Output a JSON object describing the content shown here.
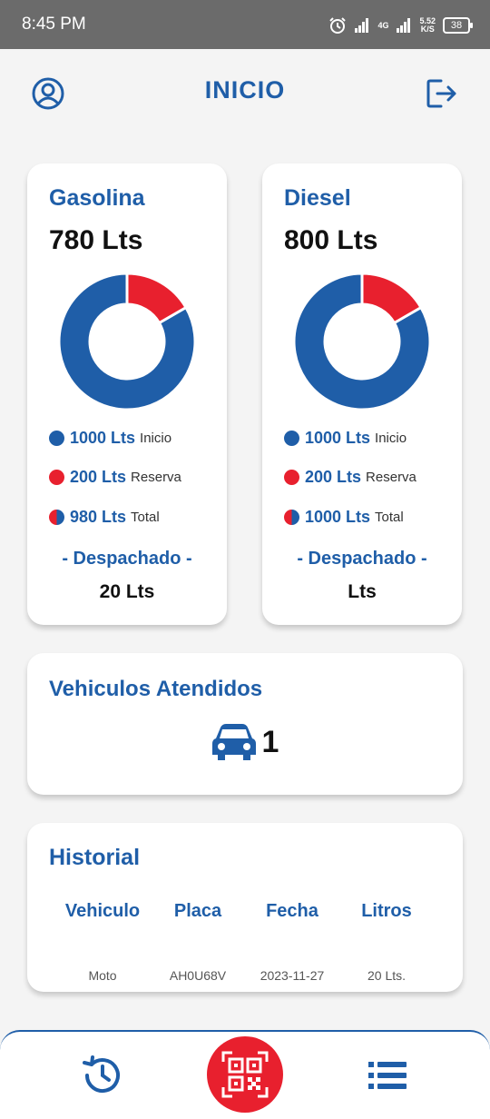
{
  "status_bar": {
    "time": "8:45 PM",
    "network": "4G",
    "speed": "5.52",
    "speed_unit": "K/S",
    "battery": "38"
  },
  "header": {
    "title": "INICIO",
    "profile_icon": "user-circle-icon",
    "logout_icon": "logout-icon"
  },
  "colors": {
    "primary": "#1f5ea8",
    "accent": "#e8202e"
  },
  "fuel_cards": [
    {
      "title": "Gasolina",
      "amount": "780 Lts",
      "chart_data": {
        "type": "pie",
        "labels": [
          "Inicio",
          "Reserva"
        ],
        "values": [
          1000,
          200
        ]
      },
      "legend": [
        {
          "value": "1000 Lts",
          "label": "Inicio"
        },
        {
          "value": "200 Lts",
          "label": "Reserva"
        },
        {
          "value": "980 Lts",
          "label": "Total"
        }
      ],
      "dispatched_label": "- Despachado -",
      "dispatched_value": "20 Lts"
    },
    {
      "title": "Diesel",
      "amount": "800 Lts",
      "chart_data": {
        "type": "pie",
        "labels": [
          "Inicio",
          "Reserva"
        ],
        "values": [
          1000,
          200
        ]
      },
      "legend": [
        {
          "value": "1000 Lts",
          "label": "Inicio"
        },
        {
          "value": "200 Lts",
          "label": "Reserva"
        },
        {
          "value": "1000 Lts",
          "label": "Total"
        }
      ],
      "dispatched_label": "- Despachado -",
      "dispatched_value": "Lts"
    }
  ],
  "vehicles": {
    "title": "Vehiculos Atendidos",
    "count": "1",
    "icon": "car-icon"
  },
  "history": {
    "title": "Historial",
    "columns": [
      "Vehiculo",
      "Placa",
      "Fecha",
      "Litros"
    ],
    "rows": [
      [
        "Moto",
        "AH0U68V",
        "2023-11-27",
        "20 Lts."
      ]
    ]
  },
  "bottom_nav": {
    "history_icon": "history-icon",
    "scan_icon": "qr-code-icon",
    "list_icon": "list-icon"
  }
}
